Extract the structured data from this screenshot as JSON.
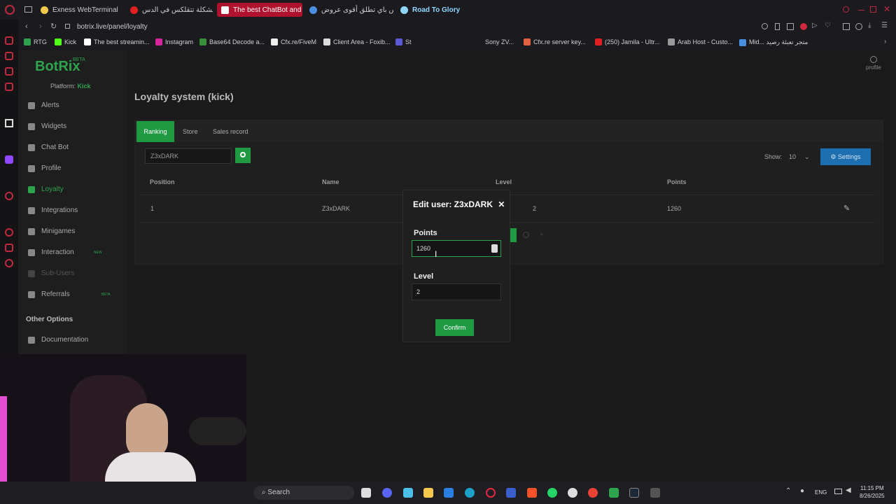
{
  "browser": {
    "tabs": [
      {
        "label": "Exness WebTerminal",
        "color": "#f2c94c"
      },
      {
        "label": "حل مشكلة تتقلكس في الدس...",
        "color": "#e02020"
      },
      {
        "label": "The best ChatBot and W...",
        "color": "#ffffff"
      },
      {
        "label": "ميداس باي تطلق أقوى عروض...",
        "color": "#4a90e2"
      },
      {
        "label": "Road To Glory",
        "color": "#8fd6ff"
      }
    ],
    "url": "botrix.live/panel/loyalty",
    "bookmarks": [
      "RTG",
      "Kick",
      "The best streamin...",
      "Instagram",
      "Base64 Decode a...",
      "Cfx.re/FiveM",
      "Client Area - Foxib...",
      "St",
      "Sony ZV...",
      "Cfx.re server key...",
      "(250) Jamila - Ultr...",
      "Arab Host - Custo...",
      "Mid... متجر تعبئة رصيد"
    ]
  },
  "app": {
    "logo": "BotRix",
    "beta": "BETA",
    "platform_label": "Platform:",
    "platform": "Kick",
    "profile_label": "profile",
    "nav": [
      {
        "label": "Alerts",
        "icon": "bell-icon"
      },
      {
        "label": "Widgets",
        "icon": "grid-icon"
      },
      {
        "label": "Chat Bot",
        "icon": "chat-icon"
      },
      {
        "label": "Profile",
        "icon": "profile-icon"
      },
      {
        "label": "Loyalty",
        "icon": "trophy-icon"
      },
      {
        "label": "Integrations",
        "icon": "puzzle-icon"
      },
      {
        "label": "Minigames",
        "icon": "gamepad-icon"
      },
      {
        "label": "Interaction",
        "icon": "music-icon",
        "tag": "NEW"
      },
      {
        "label": "Sub-Users",
        "icon": "users-icon"
      },
      {
        "label": "Referrals",
        "icon": "people-icon",
        "tag": "BETA"
      }
    ],
    "other_heading": "Other Options",
    "documentation": "Documentation"
  },
  "main": {
    "title": "Loyalty system (kick)",
    "tabs": [
      "Ranking",
      "Store",
      "Sales record"
    ],
    "search_value": "Z3xDARK",
    "show_label": "Show:",
    "show_value": "10",
    "settings_label": "Settings",
    "columns": [
      "Position",
      "Name",
      "Level",
      "Points"
    ],
    "rows": [
      {
        "position": "1",
        "name": "Z3xDARK",
        "level": "2",
        "points": "1260"
      }
    ]
  },
  "modal": {
    "title": "Edit user: Z3xDARK",
    "points_label": "Points",
    "points_value": "1260",
    "level_label": "Level",
    "level_value": "2",
    "confirm_label": "Confirm"
  },
  "taskbar": {
    "search_placeholder": "Search",
    "lang": "ENG",
    "time": "11:15 PM",
    "date": "8/26/2025"
  },
  "colors": {
    "accent": "#1f9a43",
    "settings": "#1e6fb0",
    "brand_red": "#b0122e"
  }
}
